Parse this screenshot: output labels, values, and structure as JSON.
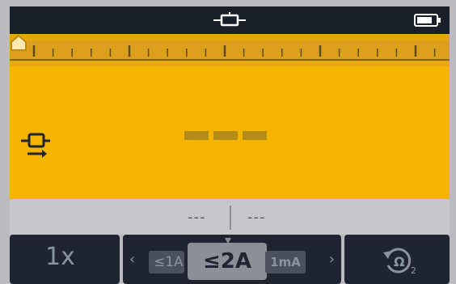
{
  "status_bar": {
    "mode_icon": "continuity-probe-icon",
    "battery_icon": "battery-icon"
  },
  "ruler": {
    "marker_position_fraction": 0.5
  },
  "display": {
    "mode_icon": "continuity-current-icon",
    "reading": "---"
  },
  "secondary": {
    "left_value": "---",
    "right_value": "---"
  },
  "softkeys": {
    "multiplier_label": "1x",
    "range": {
      "prev_icon": "chevron-left-icon",
      "left_option": "≤1A",
      "selected": "≤2A",
      "right_option": "1mA",
      "next_icon": "chevron-right-icon"
    },
    "reset": {
      "icon": "ohm-reset-icon",
      "subscript": "2"
    }
  },
  "colors": {
    "frame": "#1b1f2a",
    "display_yellow": "#f5b400",
    "ruler_yellow": "#e6a710",
    "key_bg": "#1f2430",
    "selected_bg": "#8c8f96"
  }
}
